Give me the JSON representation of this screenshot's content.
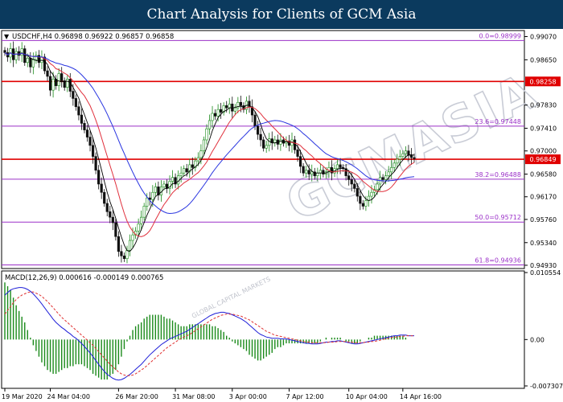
{
  "banner": {
    "title": "Chart Analysis for Clients of GCM Asia"
  },
  "watermark": {
    "text": "GCMASIA",
    "subtext": "GLOBAL CAPITAL MARKETS"
  },
  "colors": {
    "banner_bg": "#0b3a5e",
    "fib_line": "#9b30c8",
    "resistance_line": "#e00000",
    "ma_fast": "#000000",
    "ma_mid": "#e0303c",
    "ma_slow": "#2a36e0",
    "macd_line": "#1f1fd8",
    "signal_line": "#e03030",
    "histogram": "#1a8a1a",
    "candle_bull": "#1a8a1a",
    "candle_bear": "#101010"
  },
  "chart_data": [
    {
      "type": "line",
      "panel": "price",
      "symbol_info": "USDCHF,H4  0.96898 0.96922 0.96857 0.96858",
      "title": "",
      "xlabel": "",
      "ylabel": "",
      "ylim": [
        0.949,
        0.9915
      ],
      "y_ticks": [
        "0.99070",
        "0.98650",
        "0.97830",
        "0.97410",
        "0.97000",
        "0.96580",
        "0.96170",
        "0.95760",
        "0.95340",
        "0.94930"
      ],
      "y_tick_values": [
        0.9907,
        0.9865,
        0.9783,
        0.9741,
        0.97,
        0.9658,
        0.9617,
        0.9576,
        0.9534,
        0.9493
      ],
      "x_ticks": [
        "19 Mar 2020",
        "24 Mar 04:00",
        "26 Mar 20:00",
        "31 Mar 08:00",
        "3 Apr 00:00",
        "7 Apr 12:00",
        "10 Apr 04:00",
        "14 Apr 16:00"
      ],
      "x_tick_index": [
        0,
        16,
        40,
        60,
        80,
        100,
        121,
        140
      ],
      "fib_levels": [
        {
          "label": "0.0=0.98999",
          "value": 0.98999
        },
        {
          "label": "23.6=0.97448",
          "value": 0.97448
        },
        {
          "label": "38.2=0.96488",
          "value": 0.96488
        },
        {
          "label": "50.0=0.95712",
          "value": 0.95712
        },
        {
          "label": "61.8=0.94936",
          "value": 0.94936
        }
      ],
      "horizontal_levels": [
        {
          "label": "0.98258",
          "value": 0.98258
        },
        {
          "label": "0.96849",
          "value": 0.96849
        }
      ],
      "close_series": [
        0.9878,
        0.987,
        0.9885,
        0.9865,
        0.988,
        0.9873,
        0.9885,
        0.986,
        0.9868,
        0.9852,
        0.9865,
        0.9873,
        0.986,
        0.987,
        0.9845,
        0.9835,
        0.981,
        0.983,
        0.9818,
        0.984,
        0.9827,
        0.9815,
        0.983,
        0.9808,
        0.9795,
        0.978,
        0.9765,
        0.975,
        0.9738,
        0.9725,
        0.971,
        0.969,
        0.9665,
        0.964,
        0.9625,
        0.9605,
        0.959,
        0.958,
        0.957,
        0.9545,
        0.9518,
        0.951,
        0.9505,
        0.952,
        0.9538,
        0.9548,
        0.9555,
        0.9568,
        0.958,
        0.96,
        0.9615,
        0.9612,
        0.9625,
        0.9635,
        0.962,
        0.9635,
        0.964,
        0.9632,
        0.9645,
        0.9652,
        0.964,
        0.9655,
        0.966,
        0.9668,
        0.9662,
        0.9675,
        0.967,
        0.9682,
        0.9688,
        0.97,
        0.972,
        0.974,
        0.9755,
        0.9768,
        0.9763,
        0.9775,
        0.977,
        0.9782,
        0.9778,
        0.9785,
        0.9772,
        0.9778,
        0.9788,
        0.9782,
        0.9775,
        0.979,
        0.978,
        0.9765,
        0.9745,
        0.973,
        0.972,
        0.9705,
        0.971,
        0.9722,
        0.9715,
        0.972,
        0.9712,
        0.972,
        0.9714,
        0.9718,
        0.971,
        0.972,
        0.9702,
        0.969,
        0.9672,
        0.966,
        0.9665,
        0.9658,
        0.9662,
        0.9655,
        0.966,
        0.9665,
        0.9658,
        0.9662,
        0.967,
        0.966,
        0.9668,
        0.9675,
        0.967,
        0.9668,
        0.9655,
        0.9648,
        0.964,
        0.9632,
        0.9618,
        0.9605,
        0.96,
        0.961,
        0.9618,
        0.9625,
        0.963,
        0.964,
        0.9652,
        0.9648,
        0.9655,
        0.9662,
        0.967,
        0.9678,
        0.9685,
        0.969,
        0.9695,
        0.97,
        0.9692,
        0.9688,
        0.9686
      ],
      "series": [
        {
          "name": "",
          "role": "ma_fast"
        },
        {
          "name": "",
          "role": "ma_mid"
        },
        {
          "name": "",
          "role": "ma_slow"
        }
      ]
    },
    {
      "type": "line",
      "panel": "macd",
      "legend": "MACD(12,26,9) 0.000616 -0.000149 0.000765",
      "title": "",
      "xlabel": "",
      "ylabel": "",
      "ylim": [
        -0.007307,
        0.010554
      ],
      "y_ticks": [
        "0.010554",
        "0.00",
        "-0.007307"
      ],
      "y_tick_values": [
        0.010554,
        0.0,
        -0.007307
      ],
      "macd_series": [
        0.007,
        0.0074,
        0.0078,
        0.008,
        0.0081,
        0.0082,
        0.0082,
        0.0081,
        0.0079,
        0.0076,
        0.0072,
        0.0067,
        0.0062,
        0.0056,
        0.005,
        0.0044,
        0.0038,
        0.0032,
        0.0027,
        0.0023,
        0.0019,
        0.0016,
        0.0012,
        0.0009,
        0.0005,
        0.0002,
        -0.0002,
        -0.0006,
        -0.0011,
        -0.0016,
        -0.0021,
        -0.0027,
        -0.0033,
        -0.0039,
        -0.0045,
        -0.005,
        -0.0055,
        -0.0058,
        -0.0061,
        -0.0063,
        -0.0064,
        -0.0063,
        -0.0061,
        -0.0058,
        -0.0055,
        -0.0051,
        -0.0047,
        -0.0043,
        -0.0039,
        -0.0034,
        -0.0029,
        -0.0024,
        -0.002,
        -0.0016,
        -0.0012,
        -0.0008,
        -0.0005,
        -0.0002,
        0.0001,
        0.0003,
        0.0005,
        0.0007,
        0.0009,
        0.0011,
        0.0013,
        0.0016,
        0.0019,
        0.0022,
        0.0025,
        0.0028,
        0.0031,
        0.0034,
        0.0037,
        0.0039,
        0.0041,
        0.0042,
        0.0043,
        0.0043,
        0.0042,
        0.0041,
        0.0039,
        0.0037,
        0.0035,
        0.0033,
        0.003,
        0.0027,
        0.0023,
        0.0019,
        0.0015,
        0.0011,
        0.0008,
        0.0006,
        0.0004,
        0.0003,
        0.0002,
        0.0002,
        0.0002,
        0.0001,
        0.0001,
        0.0001,
        0.0,
        -0.0001,
        -0.0002,
        -0.0003,
        -0.0004,
        -0.0005,
        -0.0006,
        -0.0006,
        -0.0007,
        -0.0007,
        -0.0007,
        -0.0006,
        -0.0005,
        -0.0004,
        -0.0004,
        -0.0003,
        -0.0003,
        -0.0002,
        -0.0002,
        -0.0003,
        -0.0004,
        -0.0005,
        -0.0006,
        -0.0007,
        -0.0007,
        -0.0006,
        -0.0005,
        -0.0004,
        -0.0003,
        -0.0002,
        -0.0001,
        0.0,
        0.0001,
        0.0002,
        0.0003,
        0.0004,
        0.0005,
        0.0006,
        0.0006,
        0.0007,
        0.0007,
        0.0007,
        0.0006,
        0.0006,
        0.0006
      ],
      "signal_series": [
        0.004,
        0.0046,
        0.0052,
        0.0058,
        0.0063,
        0.0067,
        0.007,
        0.0072,
        0.0074,
        0.0075,
        0.0075,
        0.0073,
        0.0071,
        0.0068,
        0.0064,
        0.006,
        0.0055,
        0.005,
        0.0045,
        0.004,
        0.0035,
        0.0031,
        0.0027,
        0.0023,
        0.0019,
        0.0015,
        0.0011,
        0.0007,
        0.0003,
        -0.0001,
        -0.0005,
        -0.0009,
        -0.0014,
        -0.0019,
        -0.0024,
        -0.0029,
        -0.0034,
        -0.0039,
        -0.0043,
        -0.0047,
        -0.0051,
        -0.0054,
        -0.0056,
        -0.0057,
        -0.0057,
        -0.0056,
        -0.0054,
        -0.0051,
        -0.0048,
        -0.0045,
        -0.0041,
        -0.0037,
        -0.0033,
        -0.0029,
        -0.0025,
        -0.0021,
        -0.0017,
        -0.0013,
        -0.001,
        -0.0007,
        -0.0004,
        -0.0001,
        0.0002,
        0.0004,
        0.0006,
        0.0008,
        0.0011,
        0.0014,
        0.0017,
        0.002,
        0.0023,
        0.0026,
        0.0029,
        0.0032,
        0.0034,
        0.0036,
        0.0038,
        0.0039,
        0.004,
        0.004,
        0.004,
        0.0039,
        0.0038,
        0.0037,
        0.0035,
        0.0033,
        0.0031,
        0.0028,
        0.0025,
        0.0022,
        0.0019,
        0.0016,
        0.0013,
        0.0011,
        0.0009,
        0.0007,
        0.0006,
        0.0005,
        0.0004,
        0.0003,
        0.0002,
        0.0001,
        0.0,
        -0.0001,
        -0.0002,
        -0.0003,
        -0.0004,
        -0.0004,
        -0.0005,
        -0.0005,
        -0.0005,
        -0.0005,
        -0.0005,
        -0.0005,
        -0.0004,
        -0.0004,
        -0.0004,
        -0.0003,
        -0.0003,
        -0.0003,
        -0.0003,
        -0.0004,
        -0.0004,
        -0.0005,
        -0.0005,
        -0.0005,
        -0.0005,
        -0.0004,
        -0.0004,
        -0.0003,
        -0.0003,
        -0.0002,
        -0.0001,
        0.0,
        0.0001,
        0.0002,
        0.0003,
        0.0004,
        0.0004,
        0.0005,
        0.0005,
        0.0006,
        0.0006,
        0.0006,
        0.0006
      ]
    }
  ]
}
